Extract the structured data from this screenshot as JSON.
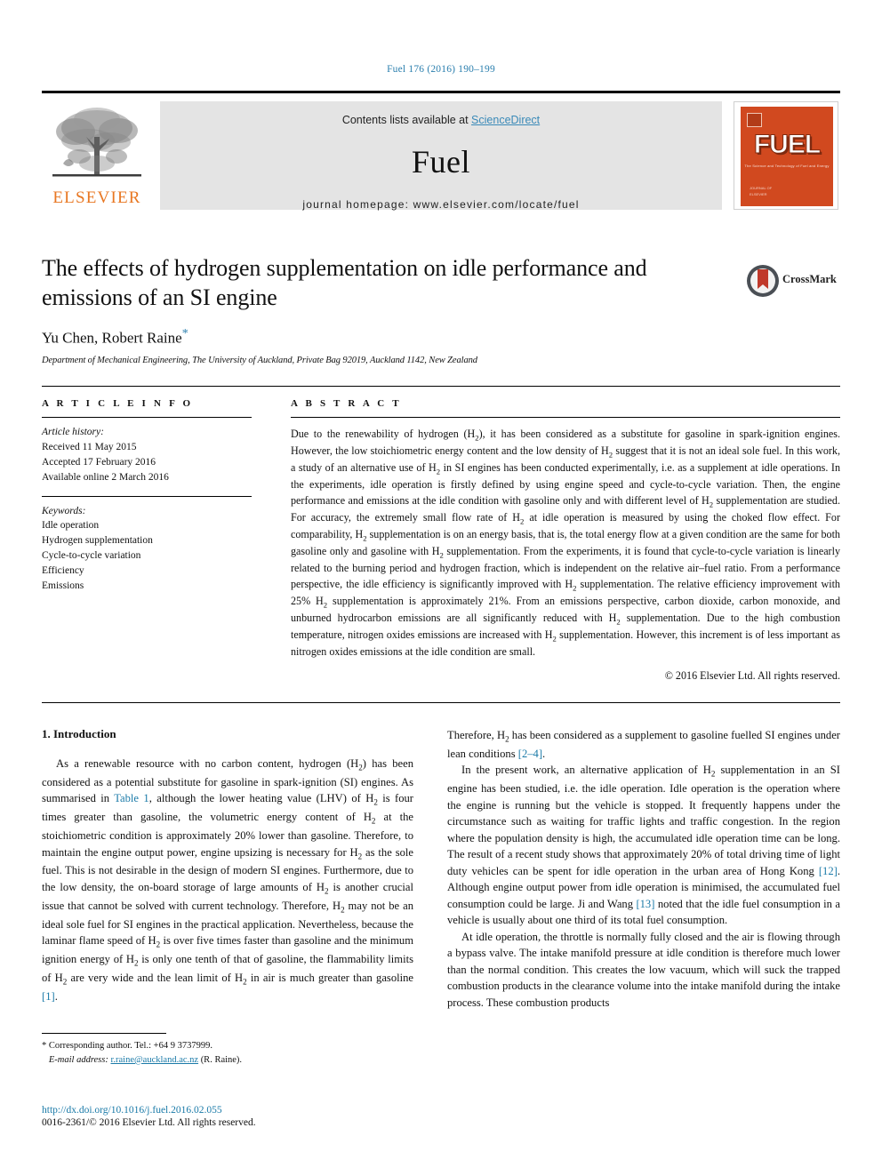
{
  "running_head": "Fuel 176 (2016) 190–199",
  "masthead": {
    "publisher": "ELSEVIER",
    "contents_prefix": "Contents lists available at ",
    "contents_link": "ScienceDirect",
    "journal_name": "Fuel",
    "homepage": "journal homepage: www.elsevier.com/locate/fuel",
    "cover": {
      "title": "FUEL",
      "subtitle": "The Science and Technology of Fuel and Energy",
      "footer": "JOURNAL OF\nELSEVIER"
    }
  },
  "article": {
    "title": "The effects of hydrogen supplementation on idle performance and emissions of an SI engine",
    "authors": "Yu Chen, Robert Raine",
    "corresponding_marker": "*",
    "affiliation": "Department of Mechanical Engineering, The University of Auckland, Private Bag 92019, Auckland 1142, New Zealand",
    "crossmark_label": "CrossMark"
  },
  "info": {
    "heading": "A R T I C L E    I N F O",
    "history_title": "Article history:",
    "history": [
      "Received 11 May 2015",
      "Accepted 17 February 2016",
      "Available online 2 March 2016"
    ],
    "keywords_title": "Keywords:",
    "keywords": [
      "Idle operation",
      "Hydrogen supplementation",
      "Cycle-to-cycle variation",
      "Efficiency",
      "Emissions"
    ]
  },
  "abstract": {
    "heading": "A B S T R A C T",
    "text": "Due to the renewability of hydrogen (H2), it has been considered as a substitute for gasoline in spark-ignition engines. However, the low stoichiometric energy content and the low density of H2 suggest that it is not an ideal sole fuel. In this work, a study of an alternative use of H2 in SI engines has been conducted experimentally, i.e. as a supplement at idle operations. In the experiments, idle operation is firstly defined by using engine speed and cycle-to-cycle variation. Then, the engine performance and emissions at the idle condition with gasoline only and with different level of H2 supplementation are studied. For accuracy, the extremely small flow rate of H2 at idle operation is measured by using the choked flow effect. For comparability, H2 supplementation is on an energy basis, that is, the total energy flow at a given condition are the same for both gasoline only and gasoline with H2 supplementation. From the experiments, it is found that cycle-to-cycle variation is linearly related to the burning period and hydrogen fraction, which is independent on the relative air–fuel ratio. From a performance perspective, the idle efficiency is significantly improved with H2 supplementation. The relative efficiency improvement with 25% H2 supplementation is approximately 21%. From an emissions perspective, carbon dioxide, carbon monoxide, and unburned hydrocarbon emissions are all significantly reduced with H2 supplementation. Due to the high combustion temperature, nitrogen oxides emissions are increased with H2 supplementation. However, this increment is of less important as nitrogen oxides emissions at the idle condition are small.",
    "copyright": "© 2016 Elsevier Ltd. All rights reserved."
  },
  "body": {
    "section_heading": "1. Introduction",
    "left_paragraphs": [
      "As a renewable resource with no carbon content, hydrogen (H2) has been considered as a potential substitute for gasoline in spark-ignition (SI) engines. As summarised in Table 1, although the lower heating value (LHV) of H2 is four times greater than gasoline, the volumetric energy content of H2 at the stoichiometric condition is approximately 20% lower than gasoline. Therefore, to maintain the engine output power, engine upsizing is necessary for H2 as the sole fuel. This is not desirable in the design of modern SI engines. Furthermore, due to the low density, the on-board storage of large amounts of H2 is another crucial issue that cannot be solved with current technology. Therefore, H2 may not be an ideal sole fuel for SI engines in the practical application. Nevertheless, because the laminar flame speed of H2 is over five times faster than gasoline and the minimum ignition energy of H2 is only one tenth of that of gasoline, the flammability limits of H2 are very wide and the lean limit of H2 in air is much greater than gasoline [1]."
    ],
    "right_paragraphs": [
      "Therefore, H2 has been considered as a supplement to gasoline fuelled SI engines under lean conditions [2–4].",
      "In the present work, an alternative application of H2 supplementation in an SI engine has been studied, i.e. the idle operation. Idle operation is the operation where the engine is running but the vehicle is stopped. It frequently happens under the circumstance such as waiting for traffic lights and traffic congestion. In the region where the population density is high, the accumulated idle operation time can be long. The result of a recent study shows that approximately 20% of total driving time of light duty vehicles can be spent for idle operation in the urban area of Hong Kong [12]. Although engine output power from idle operation is minimised, the accumulated fuel consumption could be large. Ji and Wang [13] noted that the idle fuel consumption in a vehicle is usually about one third of its total fuel consumption.",
      "At idle operation, the throttle is normally fully closed and the air is flowing through a bypass valve. The intake manifold pressure at idle condition is therefore much lower than the normal condition. This creates the low vacuum, which will suck the trapped combustion products in the clearance volume into the intake manifold during the intake process. These combustion products"
    ],
    "link_table": "Table 1",
    "link_ref_1": "[1]",
    "link_ref_24": "[2–4]",
    "link_ref_12": "[12]",
    "link_ref_13": "[13]"
  },
  "footnote": {
    "corresponding": "* Corresponding author. Tel.: +64 9 3737999.",
    "email_label": "E-mail address:",
    "email": "r.raine@auckland.ac.nz",
    "email_suffix": "(R. Raine).",
    "doi": "http://dx.doi.org/10.1016/j.fuel.2016.02.055",
    "issn": "0016-2361/© 2016 Elsevier Ltd. All rights reserved."
  },
  "colors": {
    "link_blue": "#1a7aa8",
    "header_blue": "#2b7fae",
    "elsevier_orange": "#E87722",
    "cover_red": "#d1491f",
    "banner_gray": "#e4e4e4"
  }
}
